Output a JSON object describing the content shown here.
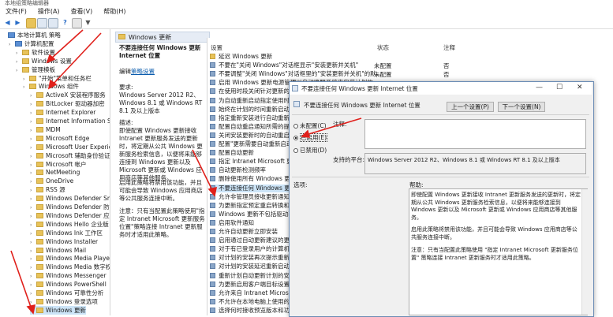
{
  "window": {
    "title": "本地组策略编辑器"
  },
  "menu": [
    "文件(F)",
    "操作(A)",
    "查看(V)",
    "帮助(H)"
  ],
  "tree": [
    {
      "label": "本地计算机 策略",
      "indent": 0,
      "icon": "computer-icon"
    },
    {
      "label": "计算机配置",
      "indent": 1,
      "icon": "computer-icon"
    },
    {
      "label": "软件设置",
      "indent": 2,
      "icon": "folder-icon"
    },
    {
      "label": "Windows 设置",
      "indent": 2,
      "icon": "folder-icon"
    },
    {
      "label": "管理模板",
      "indent": 2,
      "icon": "folder-icon"
    },
    {
      "label": "\"开始\"菜单和任务栏",
      "indent": 3,
      "icon": "folder-icon"
    },
    {
      "label": "Windows 组件",
      "indent": 3,
      "icon": "folder-icon"
    },
    {
      "label": "ActiveX 安装程序服务",
      "indent": 4,
      "icon": "folder-icon"
    },
    {
      "label": "BitLocker 驱动器加密",
      "indent": 4,
      "icon": "folder-icon"
    },
    {
      "label": "Internet Explorer",
      "indent": 4,
      "icon": "folder-icon"
    },
    {
      "label": "Internet Information Serv",
      "indent": 4,
      "icon": "folder-icon"
    },
    {
      "label": "MDM",
      "indent": 4,
      "icon": "folder-icon"
    },
    {
      "label": "Microsoft Edge",
      "indent": 4,
      "icon": "folder-icon"
    },
    {
      "label": "Microsoft User Experienc",
      "indent": 4,
      "icon": "folder-icon"
    },
    {
      "label": "Microsoft 辅助身份验证因",
      "indent": 4,
      "icon": "folder-icon"
    },
    {
      "label": "Microsoft 帐户",
      "indent": 4,
      "icon": "folder-icon"
    },
    {
      "label": "NetMeeting",
      "indent": 4,
      "icon": "folder-icon"
    },
    {
      "label": "OneDrive",
      "indent": 4,
      "icon": "folder-icon"
    },
    {
      "label": "RSS 源",
      "indent": 4,
      "icon": "folder-icon"
    },
    {
      "label": "Windows Defender Smart",
      "indent": 4,
      "icon": "folder-icon"
    },
    {
      "label": "Windows Defender 防病毒",
      "indent": 4,
      "icon": "folder-icon"
    },
    {
      "label": "Windows Defender 应用程",
      "indent": 4,
      "icon": "folder-icon"
    },
    {
      "label": "Windows Hello 企业版",
      "indent": 4,
      "icon": "folder-icon"
    },
    {
      "label": "Windows Ink 工作区",
      "indent": 4,
      "icon": "folder-icon"
    },
    {
      "label": "Windows Installer",
      "indent": 4,
      "icon": "folder-icon"
    },
    {
      "label": "Windows Mail",
      "indent": 4,
      "icon": "folder-icon"
    },
    {
      "label": "Windows Media Player",
      "indent": 4,
      "icon": "folder-icon"
    },
    {
      "label": "Windows Media 数字权限",
      "indent": 4,
      "icon": "folder-icon"
    },
    {
      "label": "Windows Messenger",
      "indent": 4,
      "icon": "folder-icon"
    },
    {
      "label": "Windows PowerShell",
      "indent": 4,
      "icon": "folder-icon"
    },
    {
      "label": "Windows 可靠性分析",
      "indent": 4,
      "icon": "folder-icon"
    },
    {
      "label": "Windows 登录选项",
      "indent": 4,
      "icon": "folder-icon"
    },
    {
      "label": "Windows 更新",
      "indent": 4,
      "icon": "folder-icon",
      "selected": true
    }
  ],
  "middle": {
    "header": "Windows 更新",
    "setting_title": "不要连接任何 Windows 更新 Internet 位置",
    "edit_prefix": "编辑",
    "edit_link": "策略设置",
    "requirements_label": "要求:",
    "requirements": "Windows Server 2012 R2、Windows 8.1 或 Windows RT 8.1 及以上版本",
    "description_label": "描述:",
    "description": "即使配置 Windows 更新接收 Intranet 更新服务发送的更新时，将定期从公共 Windows 更新服务检索信息，以便将来能够连接到 Windows 更新以及 Microsoft 更新或 Windows 应用商店等其他服务。",
    "description2": "启用此策略将禁用该功能，并且可能会导致 Windows 应用商店等公共服务连接中断。",
    "note": "注意：只有当配置此策略使用\"指定 Intranet Microsoft 更新服务位置\"策略连接 Intranet 更新服务时才适用此策略。"
  },
  "list": {
    "columns": {
      "setting": "设置",
      "state": "状态",
      "comment": "注释"
    },
    "rows": [
      {
        "label": "延迟 Windows 更新",
        "state": "",
        "comment": "",
        "folder": true
      },
      {
        "label": "不要在\"关闭 Windows\"对话框显示\"安装更新并关机\"",
        "state": "未配置",
        "comment": "否"
      },
      {
        "label": "不要调整\"关闭 Windows\"对话框里的\"安装更新并关机\"的默...",
        "state": "未配置",
        "comment": "否"
      },
      {
        "label": "启用 Windows 更新电源管理以自动唤醒系统来安装计划的...",
        "state": "",
        "comment": ""
      },
      {
        "label": "在使用时段关闭针对更新的自动重启",
        "state": "",
        "comment": ""
      },
      {
        "label": "为自动重新启动指定使用时段范围",
        "state": "",
        "comment": ""
      },
      {
        "label": "始终在计划的时间重新启动",
        "state": "",
        "comment": ""
      },
      {
        "label": "指定重新安装进行自动重新启动的...",
        "state": "",
        "comment": ""
      },
      {
        "label": "配置自动重启通知所需的提醒...",
        "state": "",
        "comment": ""
      },
      {
        "label": "关闭安装更新时的自动重启提醒",
        "state": "",
        "comment": ""
      },
      {
        "label": "配置\"更新需要自动重新启动\"...",
        "state": "",
        "comment": ""
      },
      {
        "label": "配置自动更新",
        "state": "",
        "comment": ""
      },
      {
        "label": "指定 Intranet Microsoft 更新...",
        "state": "",
        "comment": ""
      },
      {
        "label": "自动更新检测频率",
        "state": "",
        "comment": ""
      },
      {
        "label": "删除使用所有 Windows 更新功能...",
        "state": "",
        "comment": ""
      },
      {
        "label": "不要连接任何 Windows 更新 Int...",
        "state": "",
        "comment": "",
        "selected": true
      },
      {
        "label": "允许非管理员接收更新通知",
        "state": "",
        "comment": ""
      },
      {
        "label": "为更新指定预定重启转换和通知...",
        "state": "",
        "comment": ""
      },
      {
        "label": "Windows 更新不包括驱动程序",
        "state": "",
        "comment": ""
      },
      {
        "label": "启用软件通知",
        "state": "",
        "comment": ""
      },
      {
        "label": "允许自动更新立即安装",
        "state": "",
        "comment": ""
      },
      {
        "label": "启用通过自动更新建议的更新",
        "state": "",
        "comment": ""
      },
      {
        "label": "对于有已登录用户的计算机，计划...",
        "state": "",
        "comment": ""
      },
      {
        "label": "对计划的安装再次提示重新启动",
        "state": "",
        "comment": ""
      },
      {
        "label": "对计划的安装延迟重新启动",
        "state": "",
        "comment": ""
      },
      {
        "label": "重新计划自动更新计划的安装",
        "state": "",
        "comment": ""
      },
      {
        "label": "为更新启用客户端目标设置",
        "state": "",
        "comment": ""
      },
      {
        "label": "允许来自 Intranet Microsoft ...",
        "state": "",
        "comment": ""
      },
      {
        "label": "不允许在本地电脑上使用的电源...",
        "state": "",
        "comment": ""
      },
      {
        "label": "选择何时接收预览版本和功能...",
        "state": "",
        "comment": ""
      }
    ]
  },
  "dialog": {
    "title": "不要连接任何 Windows 更新 Internet 位置",
    "setting_name": "不要连接任何 Windows 更新 Internet 位置",
    "prev_button": "上一个设置(P)",
    "next_button": "下一个设置(N)",
    "radio_not_configured": "未配置(C)",
    "radio_enabled": "已启用(E)",
    "radio_disabled": "已禁用(D)",
    "selected_option": "enabled",
    "comment_label": "注释:",
    "supported_label": "支持的平台:",
    "supported_value": "Windows Server 2012 R2、Windows 8.1 或 Windows RT 8.1 及以上版本",
    "options_label": "选项:",
    "help_label": "帮助:",
    "help_text1": "即使配置 Windows 更新接收 Intranet 更新服务发送的更新时，将定期从公共 Windows 更新服务检索信息，以便将来能够连接到 Windows 更新以及 Microsoft 更新或 Windows 应用商店等其他服务。",
    "help_text2": "启用此策略将禁用该功能，并且可能会导致 Windows 应用商店等公共服务连接中断。",
    "help_text3": "注意：只有当配置此策略使用 \"指定 Intranet Microsoft 更新服务位置\" 策略连接 Intranet 更新服务时才适用此策略。"
  },
  "colors": {
    "accent": "#0b5cad",
    "selection": "#cce4f7",
    "arrow": "#e0201b"
  }
}
